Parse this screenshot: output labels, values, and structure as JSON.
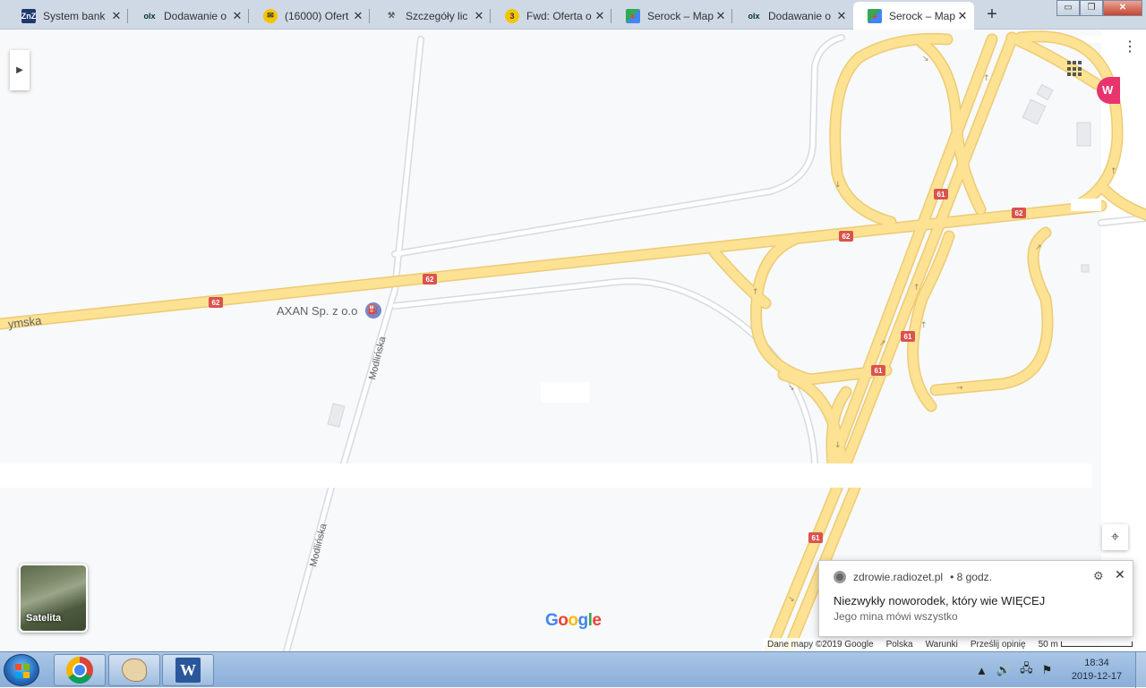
{
  "browser": {
    "tabs": [
      {
        "title": "System bank",
        "favicon": "znz",
        "active": false
      },
      {
        "title": "Dodawanie o",
        "favicon": "olx",
        "active": false
      },
      {
        "title": "(16000) Ofert",
        "favicon": "mail",
        "active": false
      },
      {
        "title": "Szczegóły lic",
        "favicon": "tool",
        "active": false
      },
      {
        "title": "Fwd: Oferta o",
        "favicon": "badge-3",
        "active": false
      },
      {
        "title": "Serock – Map",
        "favicon": "maps",
        "active": false
      },
      {
        "title": "Dodawanie o",
        "favicon": "olx",
        "active": false
      },
      {
        "title": "Serock – Map",
        "favicon": "maps",
        "active": true
      }
    ],
    "new_tab_label": "+",
    "window_controls": {
      "minimize": "▭",
      "maximize": "❐",
      "close": "✕"
    }
  },
  "map": {
    "road_labels": {
      "left_road": "ymska",
      "modlinska_upper": "Modlińska",
      "modlinska_lower": "Modlińska"
    },
    "road_shields": {
      "r62_a": "62",
      "r62_b": "62",
      "r62_c": "62",
      "r62_d": "62",
      "r61_a": "61",
      "r61_b": "61",
      "r61_c": "61",
      "r61_d": "61"
    },
    "poi": {
      "name": "AXAN Sp. z o.o",
      "icon": "fuel-station-icon"
    },
    "satellite_label": "Satelita",
    "google_logo": {
      "letters": [
        "G",
        "o",
        "o",
        "g",
        "l",
        "e"
      ],
      "colors": [
        "#4285f4",
        "#ea4335",
        "#fbbc05",
        "#4285f4",
        "#34a853",
        "#ea4335"
      ]
    },
    "footer": {
      "map_data": "Dane mapy ©2019 Google",
      "country": "Polska",
      "terms": "Warunki",
      "feedback": "Prześlij opinię",
      "scale": "50 m"
    },
    "avatar_letter": "W"
  },
  "notification": {
    "source": "zdrowie.radiozet.pl",
    "time": "• 8 godz.",
    "title": "Niezwykły noworodek, który wie WIĘCEJ",
    "body": "Jego mina mówi wszystko"
  },
  "taskbar": {
    "clock_time": "18:34",
    "clock_date": "2019-12-17",
    "apps": [
      "chrome",
      "paint",
      "word"
    ]
  },
  "colors": {
    "road_fill": "#fde293",
    "road_casing": "#f0cf7a",
    "shield_red": "#d9534f",
    "minor_road": "#ffffff",
    "minor_road_edge": "#dadce0"
  }
}
